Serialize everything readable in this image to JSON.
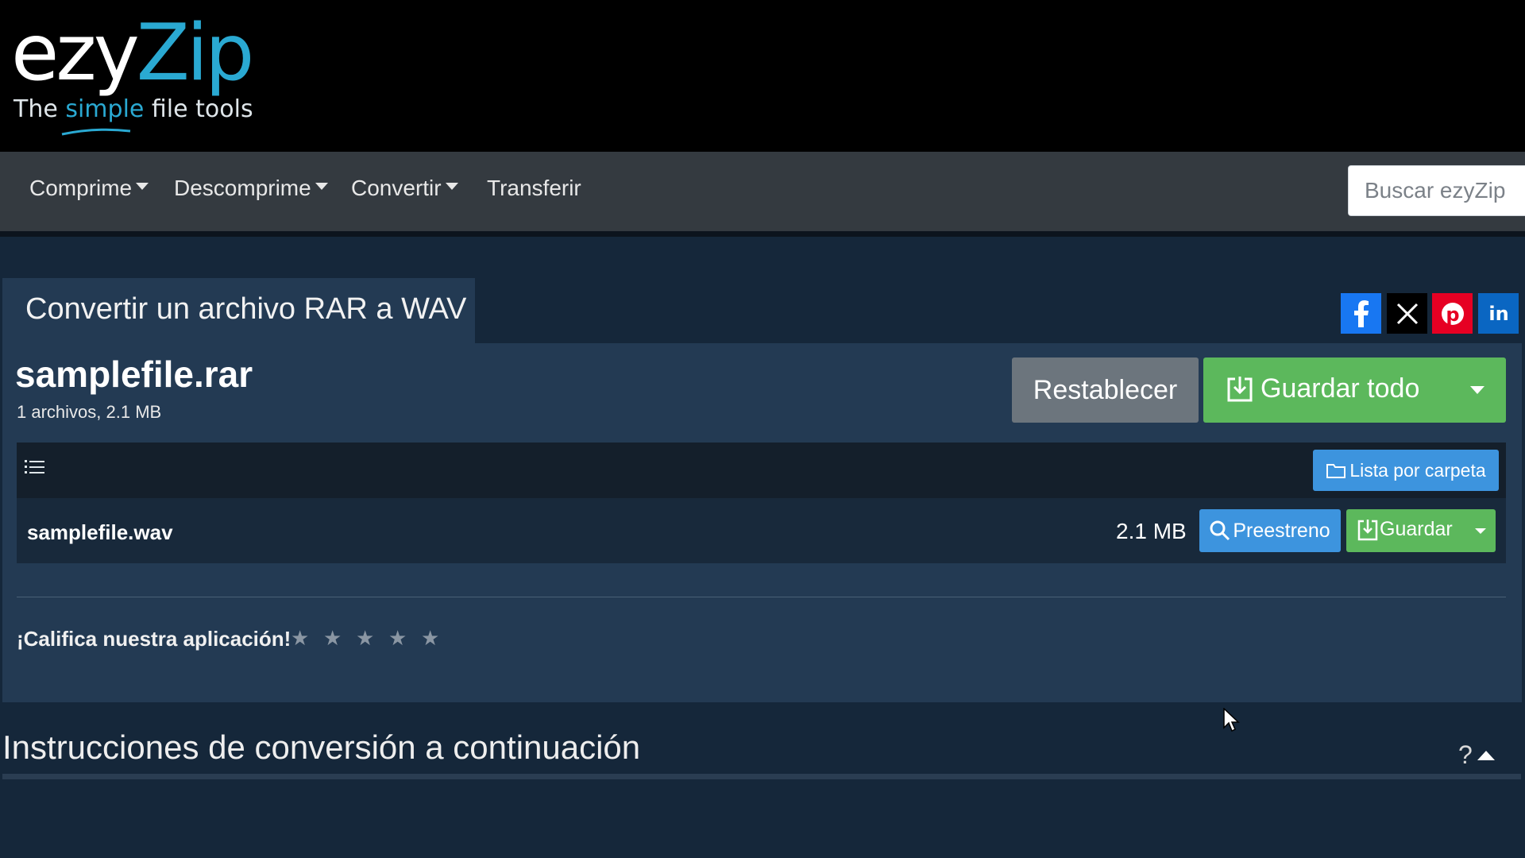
{
  "logo": {
    "main_part1": "ezy",
    "main_part2": "Zip",
    "tagline_before": "The ",
    "tagline_highlight": "simple",
    "tagline_after": " file tools"
  },
  "nav": {
    "items": [
      {
        "label": "Comprime",
        "has_dropdown": true
      },
      {
        "label": "Descomprime",
        "has_dropdown": true
      },
      {
        "label": "Convertir",
        "has_dropdown": true
      },
      {
        "label": "Transferir",
        "has_dropdown": false
      }
    ],
    "search_placeholder": "Buscar ezyZip"
  },
  "tab": {
    "label": "Convertir un archivo RAR a WAV"
  },
  "social": [
    {
      "icon": "facebook-icon",
      "color": "#1877f2"
    },
    {
      "icon": "x-twitter-icon",
      "color": "#000000"
    },
    {
      "icon": "pinterest-icon",
      "color": "#e60023"
    },
    {
      "icon": "linkedin-icon",
      "color": "#0a66c2"
    }
  ],
  "archive": {
    "name": "samplefile.rar",
    "meta": "1 archivos, 2.1 MB"
  },
  "actions": {
    "reset_label": "Restablecer",
    "save_all_label": "Guardar todo",
    "folder_list_label": "Lista por carpeta"
  },
  "files": [
    {
      "name": "samplefile.wav",
      "size": "2.1 MB",
      "preview_label": "Preestreno",
      "save_label": "Guardar"
    }
  ],
  "rating": {
    "label": "¡Califica nuestra aplicación!",
    "max_stars": 5,
    "star_glyph": "★"
  },
  "instructions": {
    "title": "Instrucciones de conversión a continuación",
    "help_label": "?"
  },
  "colors": {
    "header_bg": "#000000",
    "nav_bg": "#343a40",
    "panel_bg": "#233a53",
    "page_bg": "#15273a",
    "brand_accent": "#2aa9d2",
    "primary_blue": "#3d94de",
    "success_green": "#5cb85c",
    "secondary_gray": "#6c757d"
  }
}
